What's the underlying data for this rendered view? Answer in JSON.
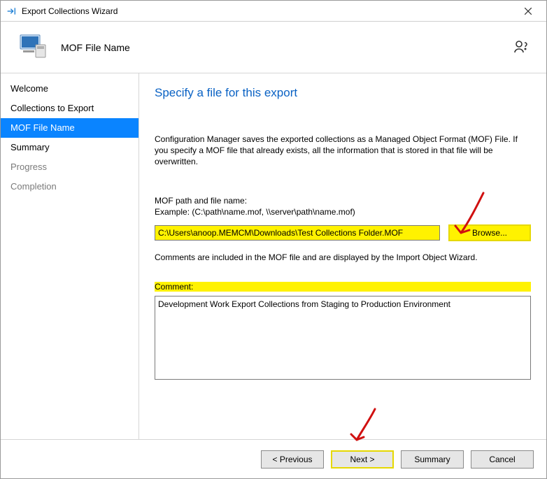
{
  "window": {
    "title": "Export Collections Wizard"
  },
  "header": {
    "page_name": "MOF File Name"
  },
  "sidebar": {
    "items": [
      {
        "label": "Welcome",
        "state": "normal"
      },
      {
        "label": "Collections to Export",
        "state": "normal"
      },
      {
        "label": "MOF File Name",
        "state": "active"
      },
      {
        "label": "Summary",
        "state": "normal"
      },
      {
        "label": "Progress",
        "state": "muted"
      },
      {
        "label": "Completion",
        "state": "muted"
      }
    ]
  },
  "main": {
    "heading": "Specify a file for this export",
    "description": "Configuration Manager saves the exported collections as a Managed Object Format (MOF) File. If you specify a MOF file that already exists, all the information that is stored in that file will be overwritten.",
    "path_label": "MOF path and file name:",
    "path_example": "Example: (C:\\path\\name.mof, \\\\server\\path\\name.mof)",
    "path_value": "C:\\Users\\anoop.MEMCM\\Downloads\\Test Collections Folder.MOF",
    "browse_label": "Browse...",
    "comments_note": "Comments are included in the MOF file and are displayed by the Import Object Wizard.",
    "comment_label": "Comment:",
    "comment_value": "Development Work Export Collections from Staging to Production Environment"
  },
  "footer": {
    "previous": "< Previous",
    "next": "Next >",
    "summary": "Summary",
    "cancel": "Cancel"
  }
}
